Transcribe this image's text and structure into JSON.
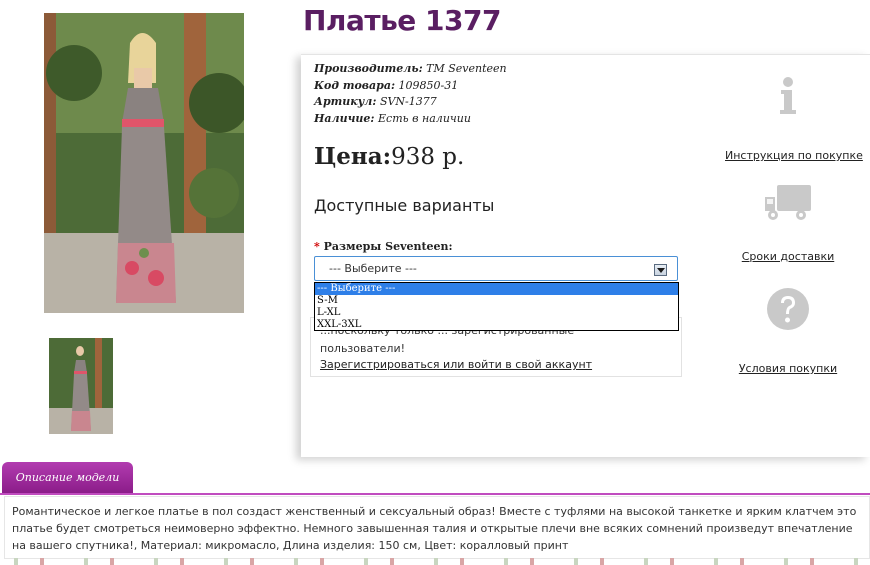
{
  "product": {
    "title": "Платье 1377",
    "specs": [
      {
        "label": "Производитель:",
        "value": "ТМ Seventeen"
      },
      {
        "label": "Код товара:",
        "value": "109850-31"
      },
      {
        "label": "Артикул:",
        "value": "SVN-1377"
      },
      {
        "label": "Наличие:",
        "value": "Есть в наличии"
      }
    ],
    "price_label": "Цена:",
    "price_value": "938 р.",
    "variants_title": "Доступные варианты",
    "size": {
      "required_mark": "*",
      "label": "Размеры Seventeen:",
      "selected": "--- Выберите ---",
      "options": [
        "--- Выберите ---",
        "S-M",
        "L-XL",
        "XXL-3XL"
      ]
    },
    "notice": {
      "line1": "...поскольку только ... зарегистрированные",
      "line2": "пользователи!",
      "link": "Зарегистрироваться или войти в свой аккаунт"
    }
  },
  "services": [
    {
      "label": "Инструкция по покупке",
      "icon": "info-icon"
    },
    {
      "label": "Сроки доставки",
      "icon": "truck-icon"
    },
    {
      "label": "Условия покупки",
      "icon": "question-icon"
    }
  ],
  "description": {
    "tab_label": "Описание модели",
    "text": "Романтическое и легкое платье в пол создаст женственный и сексуальный образ! Вместе с туфлями на высокой танкетке и ярким клатчем это платье будет смотреться неимоверно эффектно. Немного завышенная талия и открытые плечи вне всяких сомнений произведут впечатление на вашего спутника!, Материал: микромасло, Длина изделия: 150 см, Цвет: коралловый принт"
  },
  "colors": {
    "title": "#5a1e62",
    "tab": "#9a2a98",
    "select_border": "#4a90d6",
    "selected_option": "#2e7fe8",
    "icon_gray": "#c9c9c9"
  }
}
